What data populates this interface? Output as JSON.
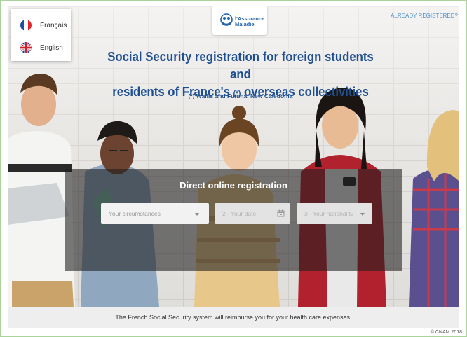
{
  "language_menu": {
    "items": [
      {
        "label": "Français",
        "icon": "france-flag-icon"
      },
      {
        "label": "English",
        "icon": "uk-flag-icon"
      }
    ]
  },
  "header": {
    "logo_text": [
      "l'Assurance",
      "Maladie"
    ],
    "already_registered": "ALREADY REGISTERED?"
  },
  "hero": {
    "title_line1": "Social Security registration for foreign students and",
    "title_line2_a": "residents of France's",
    "title_line2_ast": "(*)",
    "title_line2_b": "overseas collectivities",
    "subtitle": "(*) Wallis and Futuna, New Caledonia"
  },
  "registration": {
    "title": "Direct online registration",
    "fields": [
      {
        "placeholder": "Your circumstances",
        "icon": "chevron-down-icon",
        "enabled": true
      },
      {
        "placeholder": "2 - Your date",
        "icon": "calendar-icon",
        "enabled": false
      },
      {
        "placeholder": "3 - Your nationality",
        "icon": "chevron-down-icon",
        "enabled": false
      }
    ]
  },
  "footer": {
    "message": "The French Social Security system will reimburse you for your health care expenses.",
    "copyright": "© CNAM 2018"
  },
  "colors": {
    "title_blue": "#1e4f91",
    "link_blue": "#4a90c8",
    "panel_overlay": "rgba(30,30,30,0.58)"
  }
}
